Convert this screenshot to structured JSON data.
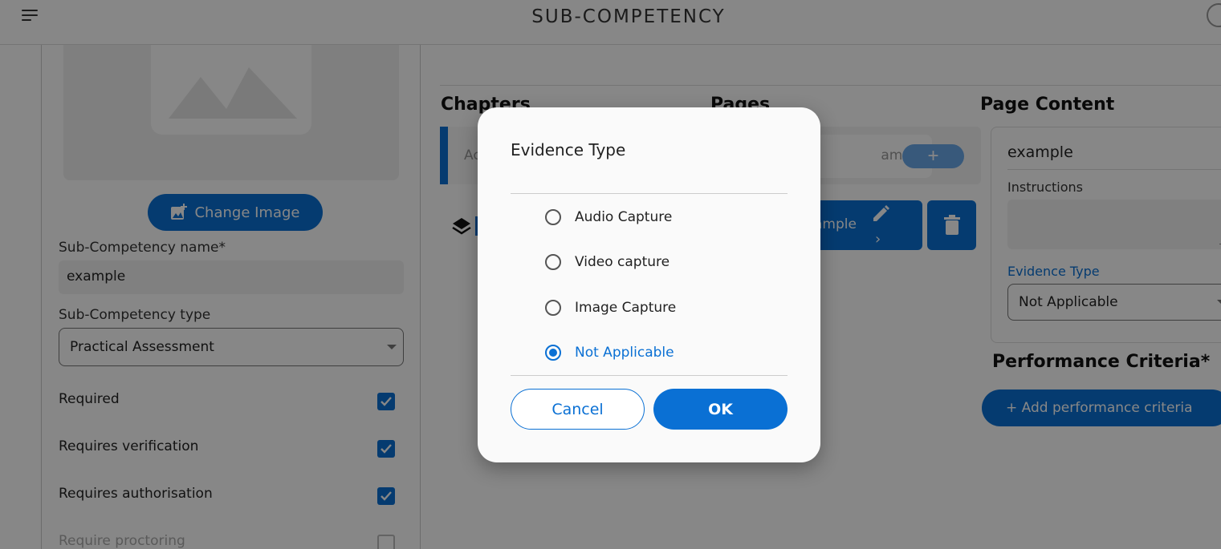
{
  "header": {
    "title": "SUB-COMPETENCY",
    "menu_icon": "hamburger-menu-icon",
    "avatar_icon": "user-avatar-icon"
  },
  "left_panel": {
    "image_placeholder_icon": "image-placeholder-icon",
    "change_image_label": "Change Image",
    "change_image_icon": "add-photo-icon",
    "name_label": "Sub-Competency name*",
    "name_value": "example",
    "type_label": "Sub-Competency type",
    "type_value": "Practical Assessment",
    "checks": [
      {
        "label": "Required",
        "checked": true
      },
      {
        "label": "Requires verification",
        "checked": true
      },
      {
        "label": "Requires authorisation",
        "checked": true
      },
      {
        "label": "Require proctoring",
        "checked": false
      }
    ]
  },
  "content": {
    "chapters_heading": "Chapters",
    "chapter_input_placeholder": "Ac",
    "pages_heading": "Pages",
    "pages_input_placeholder": "ame h",
    "pages_add_label": "+",
    "page_item_label": "ample",
    "page_content_heading": "Page Content",
    "page_title_value": "example",
    "instructions_label": "Instructions",
    "evidence_type_label": "Evidence Type",
    "evidence_type_value": "Not Applicable",
    "performance_heading": "Performance Criteria*",
    "add_performance_label": "+ Add performance criteria"
  },
  "dialog": {
    "title": "Evidence Type",
    "options": [
      {
        "label": "Audio Capture",
        "selected": false
      },
      {
        "label": "Video capture",
        "selected": false
      },
      {
        "label": "Image Capture",
        "selected": false
      },
      {
        "label": "Not Applicable",
        "selected": true
      }
    ],
    "cancel_label": "Cancel",
    "ok_label": "OK"
  },
  "colors": {
    "accent": "#0a70d4",
    "overlay": "rgba(0,0,0,0.47)"
  }
}
